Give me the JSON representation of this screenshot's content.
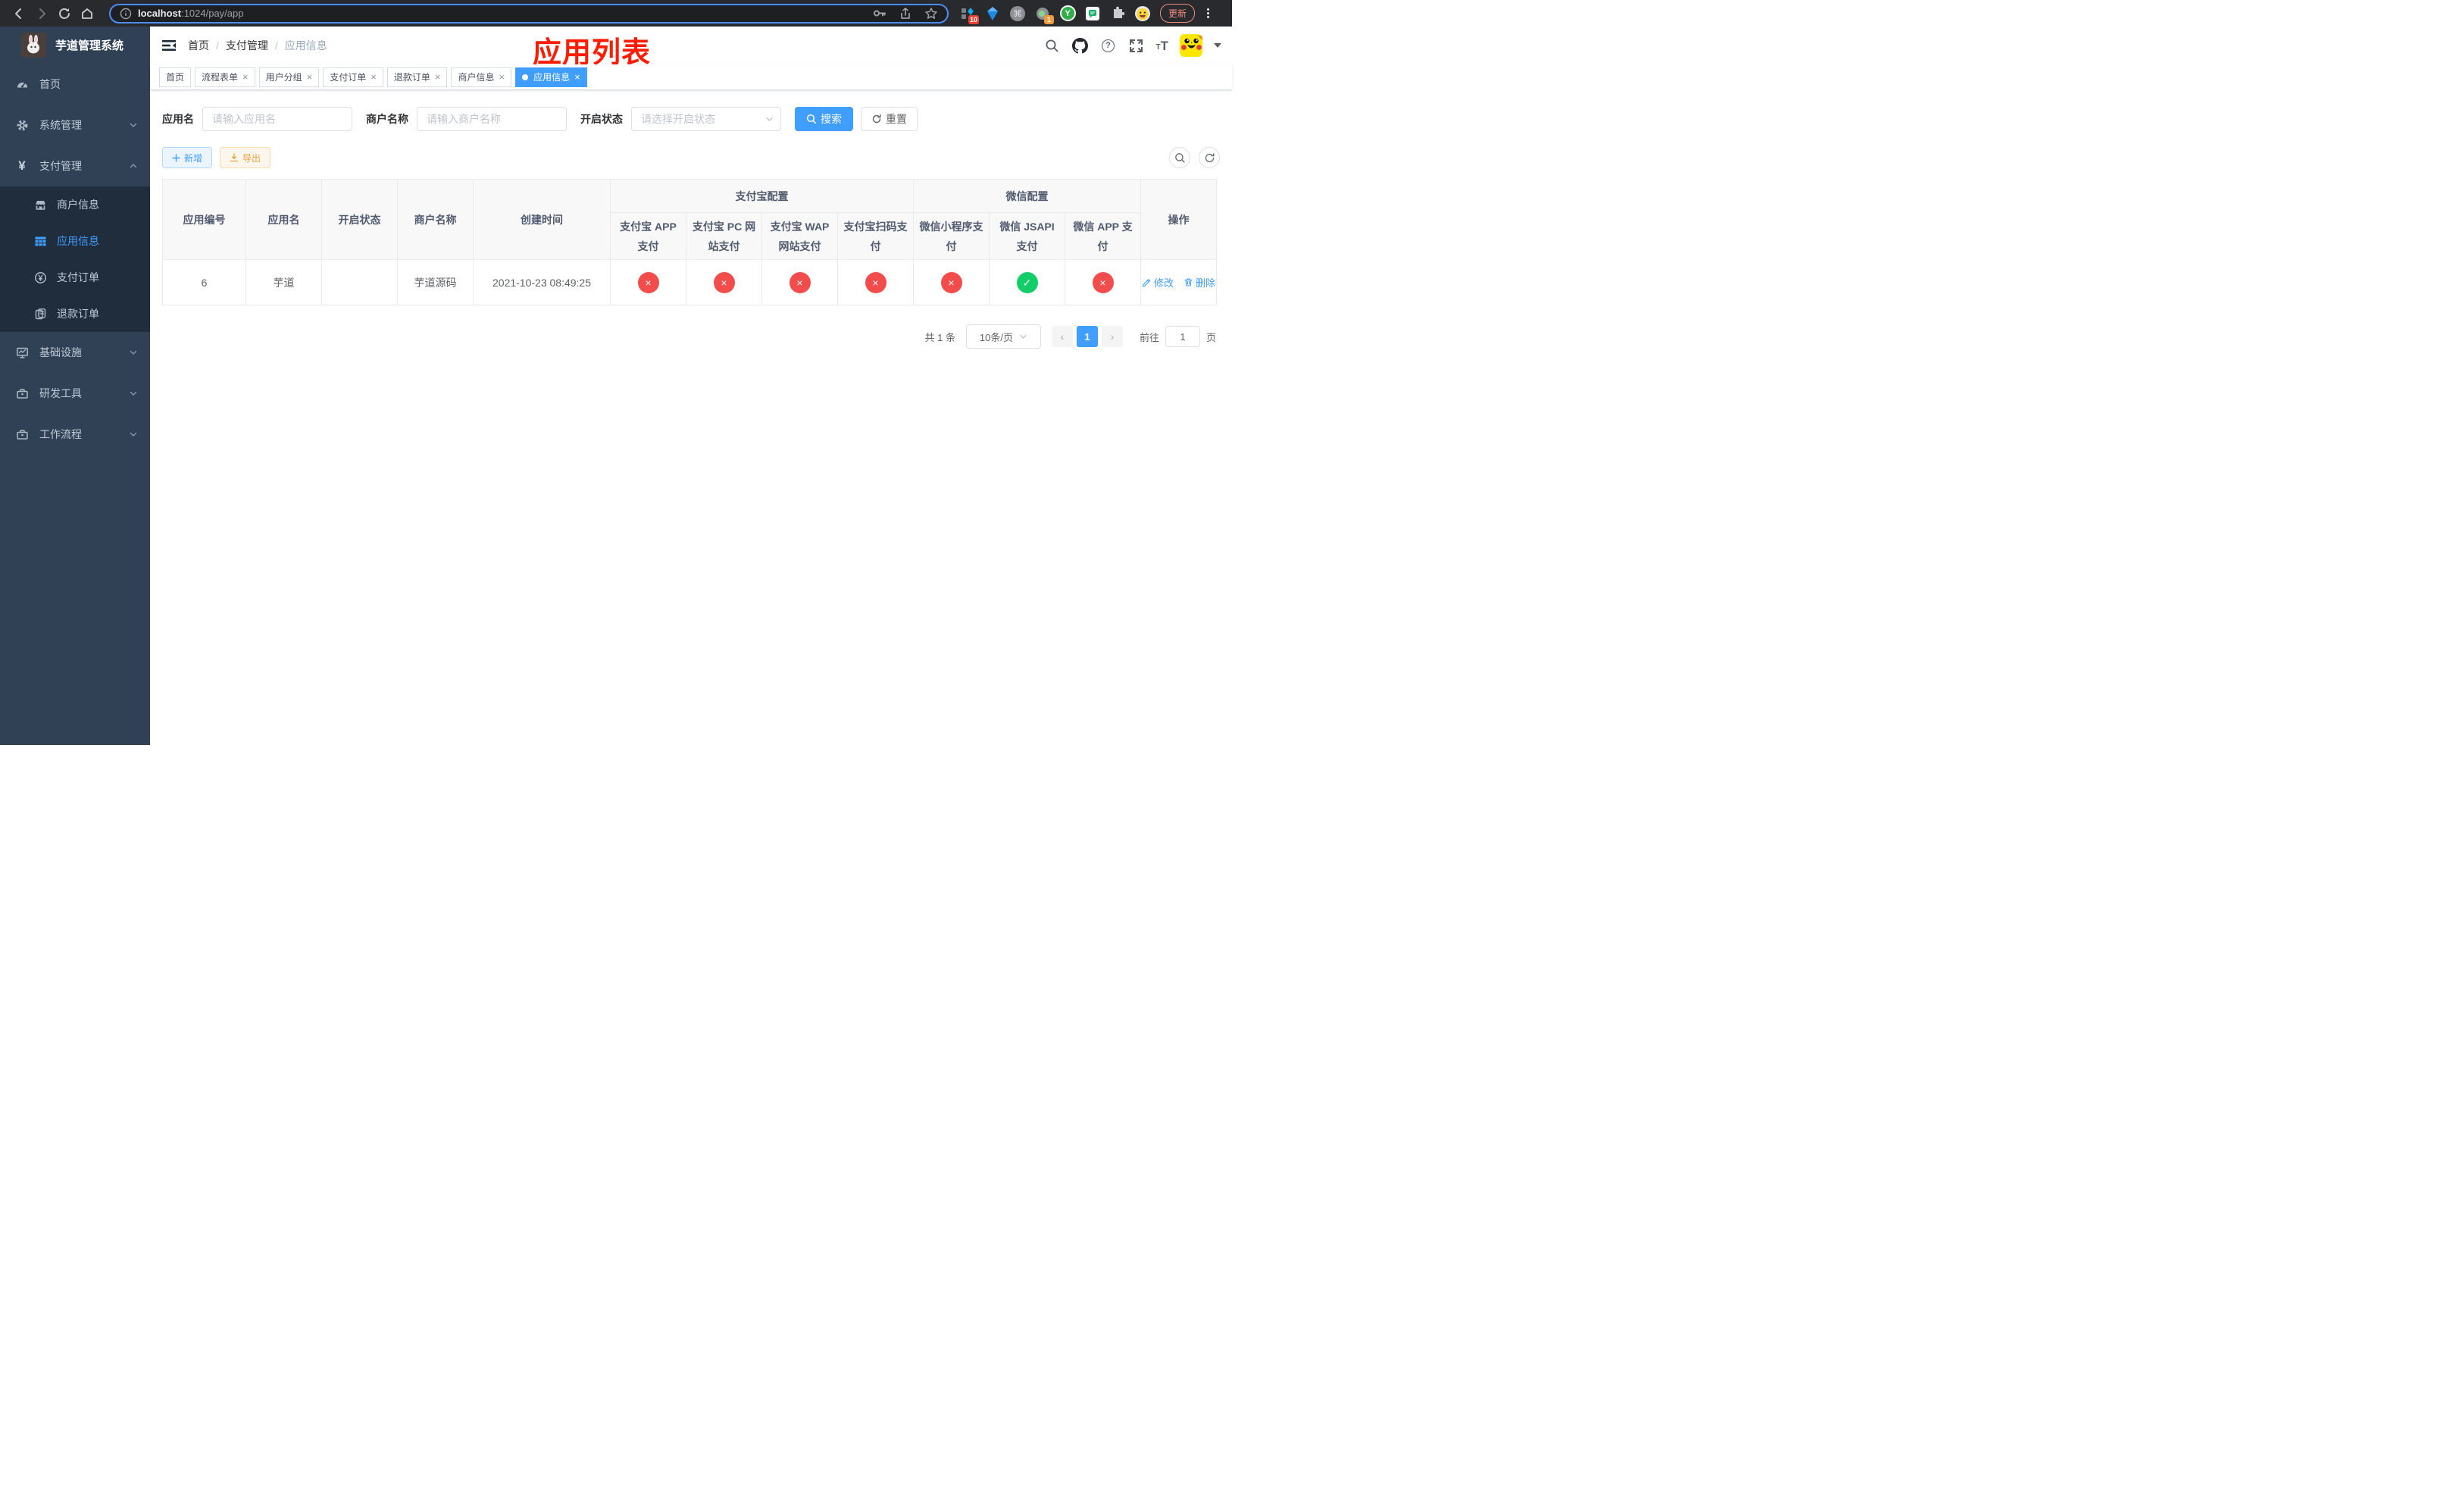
{
  "browser": {
    "url_host": "localhost",
    "url_path": ":1024/pay/app",
    "update_label": "更新",
    "badge_blocks": "10",
    "badge_profile": "1",
    "y_label": "Y"
  },
  "icons": {
    "fail": "×",
    "success": "✓",
    "command": "⌘",
    "help": "?",
    "font_small": "T",
    "font_big": "T"
  },
  "sidebar": {
    "title": "芋道管理系统",
    "items": [
      {
        "label": "首页"
      },
      {
        "label": "系统管理"
      },
      {
        "label": "支付管理"
      },
      {
        "label": "商户信息"
      },
      {
        "label": "应用信息"
      },
      {
        "label": "支付订单"
      },
      {
        "label": "退款订单"
      },
      {
        "label": "基础设施"
      },
      {
        "label": "研发工具"
      },
      {
        "label": "工作流程"
      }
    ]
  },
  "header": {
    "breadcrumb": [
      "首页",
      "支付管理",
      "应用信息"
    ],
    "separator": "/",
    "annotation": "应用列表"
  },
  "tabs": {
    "close": "×",
    "items": [
      {
        "label": "首页"
      },
      {
        "label": "流程表单"
      },
      {
        "label": "用户分组"
      },
      {
        "label": "支付订单"
      },
      {
        "label": "退款订单"
      },
      {
        "label": "商户信息"
      },
      {
        "label": "应用信息"
      }
    ]
  },
  "filters": {
    "app_name_label": "应用名",
    "app_name_placeholder": "请输入应用名",
    "merchant_label": "商户名称",
    "merchant_placeholder": "请输入商户名称",
    "status_label": "开启状态",
    "status_placeholder": "请选择开启状态",
    "search_label": "搜索",
    "reset_label": "重置"
  },
  "toolbar": {
    "add_label": "新增",
    "export_label": "导出"
  },
  "table": {
    "headers": {
      "app_id": "应用编号",
      "app_name": "应用名",
      "status": "开启状态",
      "merchant": "商户名称",
      "created": "创建时间",
      "group_alipay": "支付宝配置",
      "group_wechat": "微信配置",
      "actions": "操作"
    },
    "sub": [
      "支付宝 APP 支付",
      "支付宝 PC 网站支付",
      "支付宝 WAP 网站支付",
      "支付宝扫码支付",
      "微信小程序支付",
      "微信 JSAPI 支付",
      "微信 APP 支付"
    ],
    "row": {
      "app_id": "6",
      "app_name": "芋道",
      "enabled": true,
      "merchant": "芋道源码",
      "created": "2021-10-23 08:49:25",
      "pay_status": [
        "fail",
        "fail",
        "fail",
        "fail",
        "fail",
        "success",
        "fail"
      ]
    },
    "actions": {
      "edit": "修改",
      "delete": "删除"
    }
  },
  "pagination": {
    "total": "共 1 条",
    "per_page": "10条/页",
    "prev": "‹",
    "next": "›",
    "page": "1",
    "goto": "前往",
    "goto_value": "1",
    "suffix": "页"
  },
  "colors": {
    "accent": "#409eff",
    "sidebar_bg": "#304156",
    "submenu_bg": "#1f2d3d",
    "fail": "#f24c4c",
    "success": "#13ce66",
    "annotation": "#fe1d00"
  }
}
